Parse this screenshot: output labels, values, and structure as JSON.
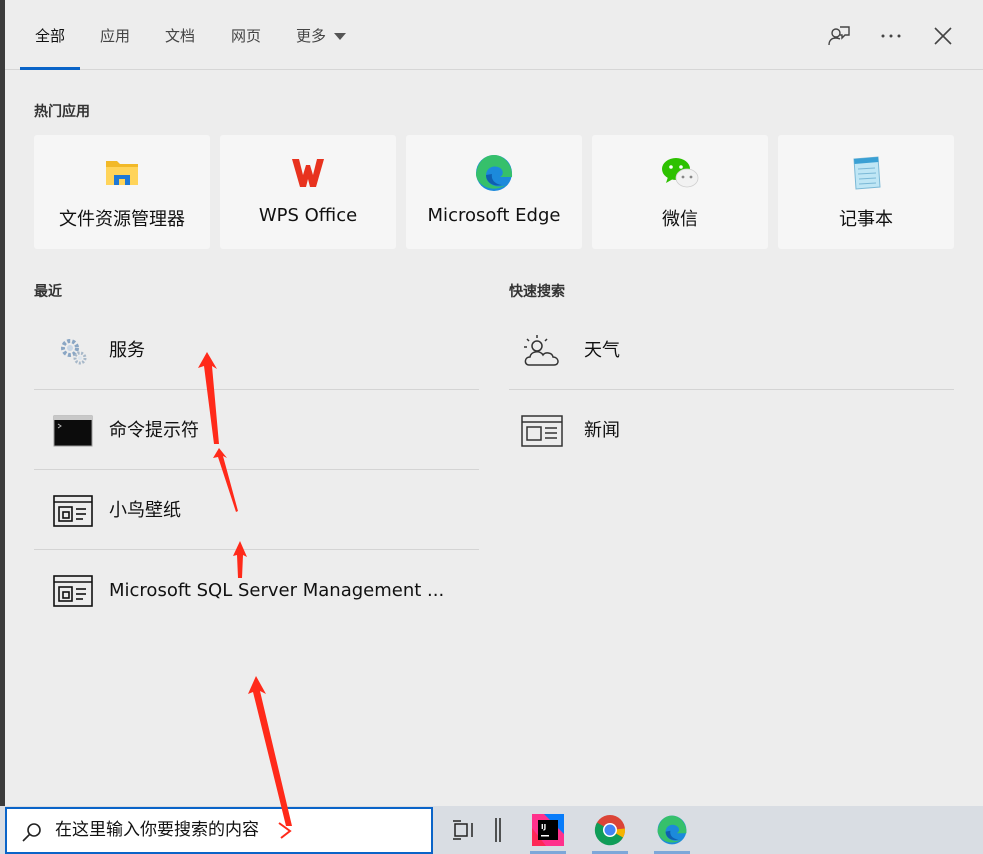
{
  "tabs": [
    {
      "label": "全部"
    },
    {
      "label": "应用"
    },
    {
      "label": "文档"
    },
    {
      "label": "网页"
    },
    {
      "label": "更多"
    }
  ],
  "sections": {
    "top_apps": "热门应用",
    "recent": "最近",
    "quick_search": "快速搜索"
  },
  "top_apps": [
    {
      "label": "文件资源管理器",
      "icon": "file-explorer-icon"
    },
    {
      "label": "WPS Office",
      "icon": "wps-office-icon"
    },
    {
      "label": "Microsoft Edge",
      "icon": "edge-icon"
    },
    {
      "label": "微信",
      "icon": "wechat-icon"
    },
    {
      "label": "记事本",
      "icon": "notepad-icon"
    }
  ],
  "recent": [
    {
      "label": "服务",
      "icon": "services-gear-icon"
    },
    {
      "label": "命令提示符",
      "icon": "command-prompt-icon"
    },
    {
      "label": "小鸟壁纸",
      "icon": "app-window-icon"
    },
    {
      "label": "Microsoft SQL Server Management ...",
      "icon": "app-window-icon"
    }
  ],
  "quick_search": [
    {
      "label": "天气",
      "icon": "weather-cloud-sun-icon"
    },
    {
      "label": "新闻",
      "icon": "news-icon"
    }
  ],
  "search": {
    "text": "在这里输入你要搜索的内容"
  },
  "taskbar_icons": [
    "task-view-icon",
    "intellij-idea-icon",
    "chrome-icon",
    "edge-icon"
  ],
  "colors": {
    "accent": "#0a64c8",
    "panel_bg": "#ededed",
    "tile_bg": "#f6f6f6",
    "annotation_arrow": "#ff2a1a"
  }
}
